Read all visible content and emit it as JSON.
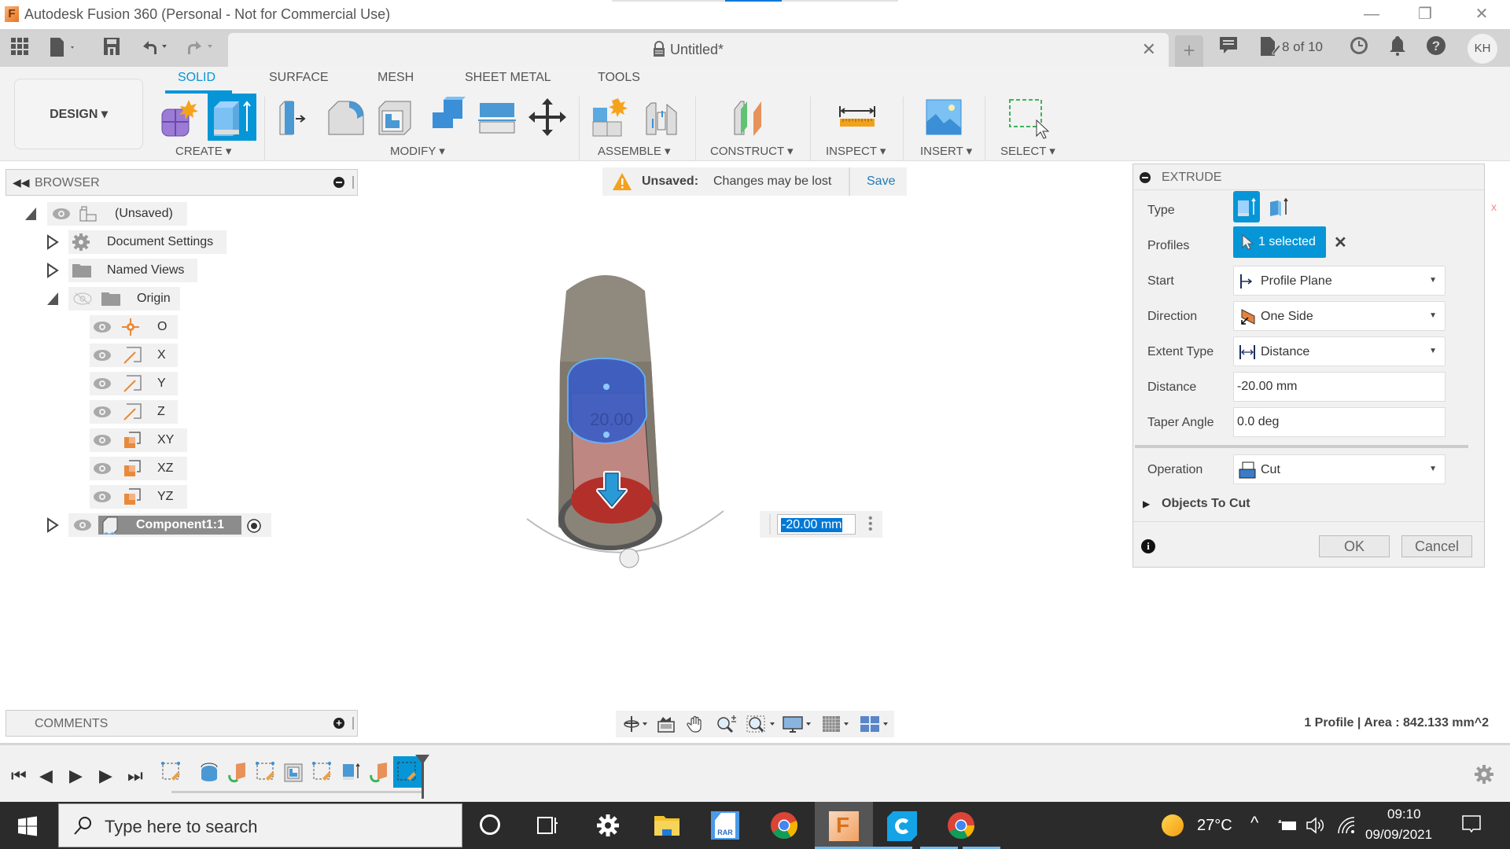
{
  "window": {
    "title": "Autodesk Fusion 360 (Personal - Not for Commercial Use)",
    "app_icon_letter": "F",
    "minimize_icon": "—",
    "restore_icon": "❐",
    "close_icon": "✕"
  },
  "quick_access": {
    "document_tab": "Untitled*",
    "job_status": "8 of 10",
    "user_initials": "KH"
  },
  "ribbon": {
    "workspace_button": "DESIGN ▾",
    "tabs": [
      {
        "label": "SOLID",
        "active": true
      },
      {
        "label": "SURFACE",
        "active": false
      },
      {
        "label": "MESH",
        "active": false
      },
      {
        "label": "SHEET METAL",
        "active": false
      },
      {
        "label": "TOOLS",
        "active": false
      }
    ],
    "groups": [
      {
        "label": "CREATE ▾",
        "tools": [
          "new-component",
          "extrude"
        ]
      },
      {
        "label": "MODIFY ▾",
        "tools": [
          "press-pull",
          "fillet",
          "shell",
          "combine",
          "offset-face",
          "move"
        ]
      },
      {
        "label": "ASSEMBLE ▾",
        "tools": [
          "new-component-assemble",
          "joint"
        ]
      },
      {
        "label": "CONSTRUCT ▾",
        "tools": [
          "offset-plane"
        ]
      },
      {
        "label": "INSPECT ▾",
        "tools": [
          "measure"
        ]
      },
      {
        "label": "INSERT ▾",
        "tools": [
          "insert-image"
        ]
      },
      {
        "label": "SELECT ▾",
        "tools": [
          "select-window"
        ]
      }
    ]
  },
  "browser": {
    "title": "BROWSER",
    "items": [
      {
        "label": "(Unsaved)",
        "icon": "component-icon",
        "level": 0,
        "expanded": true
      },
      {
        "label": "Document Settings",
        "icon": "gear-icon",
        "level": 1,
        "expanded": false
      },
      {
        "label": "Named Views",
        "icon": "folder-icon",
        "level": 1,
        "expanded": false
      },
      {
        "label": "Origin",
        "icon": "folder-icon",
        "level": 1,
        "expanded": true,
        "visible": false
      },
      {
        "label": "O",
        "icon": "origin-point-icon",
        "level": 2
      },
      {
        "label": "X",
        "icon": "axis-icon",
        "level": 2
      },
      {
        "label": "Y",
        "icon": "axis-icon",
        "level": 2
      },
      {
        "label": "Z",
        "icon": "axis-icon",
        "level": 2
      },
      {
        "label": "XY",
        "icon": "plane-icon",
        "level": 2
      },
      {
        "label": "XZ",
        "icon": "plane-icon",
        "level": 2
      },
      {
        "label": "YZ",
        "icon": "plane-icon",
        "level": 2
      },
      {
        "label": "Component1:1",
        "icon": "body-icon",
        "level": 1,
        "expanded": false,
        "active": true
      }
    ]
  },
  "unsaved_banner": {
    "label": "Unsaved:",
    "message": "Changes may be lost",
    "save_link": "Save"
  },
  "viewport": {
    "dimension_label": "20.00",
    "dimension_input": "-20.00 mm"
  },
  "extrude_panel": {
    "title": "EXTRUDE",
    "rows": {
      "type_label": "Type",
      "profiles_label": "Profiles",
      "profiles_value": "1 selected",
      "start_label": "Start",
      "start_value": "Profile Plane",
      "direction_label": "Direction",
      "direction_value": "One Side",
      "extent_label": "Extent Type",
      "extent_value": "Distance",
      "distance_label": "Distance",
      "distance_value": "-20.00 mm",
      "taper_label": "Taper Angle",
      "taper_value": "0.0 deg",
      "operation_label": "Operation",
      "operation_value": "Cut",
      "objects_to_cut": "Objects To Cut"
    },
    "ok_label": "OK",
    "cancel_label": "Cancel",
    "error_mark": "x"
  },
  "comments": {
    "title": "COMMENTS"
  },
  "status": {
    "profile_info": "1 Profile | Area : 842.133 mm^2"
  },
  "timeline": {
    "features": [
      "sketch",
      "revolve",
      "plane",
      "sketch",
      "shell",
      "sketch",
      "extrude",
      "plane",
      "sketch-active"
    ]
  },
  "taskbar": {
    "search_placeholder": "Type here to search",
    "temperature": "27°C",
    "time": "09:10",
    "date": "09/09/2021",
    "rar_label": "RAR"
  },
  "colors": {
    "accent": "#0696d7",
    "taskbar": "#2b2b2b",
    "cut_red": "#c0302a",
    "profile_blue": "#3a5cc6"
  }
}
